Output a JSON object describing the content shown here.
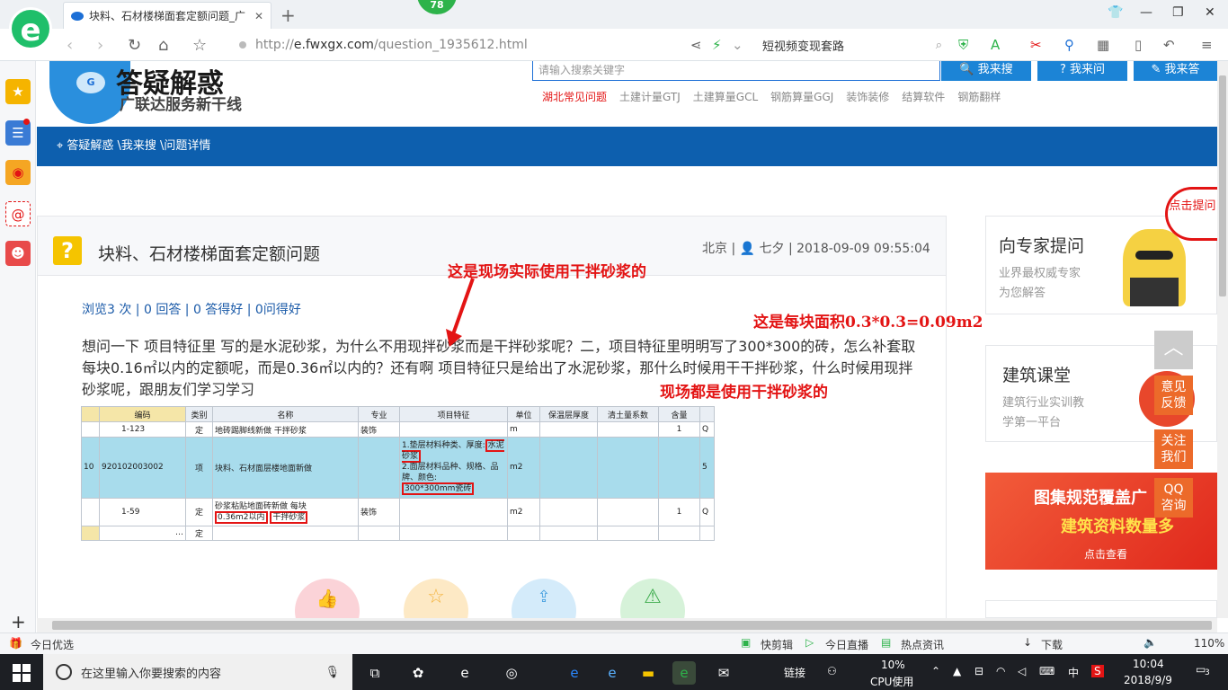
{
  "browser": {
    "tab_title": "块料、石材楼梯面套定额问题_广",
    "badge_count": "78",
    "url_host": "e.fwxgx.com",
    "url_prefix": "http://",
    "url_path": "/question_1935612.html",
    "search_text": "短视频变现套路",
    "status_left": "今日优选",
    "status_items": [
      "快剪辑",
      "今日直播",
      "热点资讯",
      "下载"
    ],
    "zoom": "110%"
  },
  "site": {
    "logo_title": "答疑解惑",
    "logo_subtitle": "广联达服务新干线",
    "search_placeholder": "请输入搜索关键字",
    "btn_search": "我来搜",
    "btn_ask": "我来问",
    "btn_answer": "我来答",
    "tags": [
      "湖北常见问题",
      "土建计量GTJ",
      "土建算量GCL",
      "钢筋算量GGJ",
      "装饰装修",
      "结算软件",
      "钢筋翻样"
    ],
    "breadcrumb": "答疑解惑 \\我来搜 \\问题详情"
  },
  "question": {
    "title": "块料、石材楼梯面套定额问题",
    "meta": "北京 | 👤 七夕 | 2018-09-09 09:55:04",
    "stats": "浏览3 次 | 0 回答 | 0 答得好 | 0问得好",
    "body": "想问一下 项目特征里 写的是水泥砂浆，为什么不用现拌砂浆而是干拌砂浆呢？二，项目特征里明明写了300*300的砖，怎么补套取每块0.16㎡以内的定额呢，而是0.36㎡以内的？还有啊  项目特征只是给出了水泥砂浆，那什么时候用干干拌砂浆，什么时候用现拌砂浆呢，跟朋友们学习学习"
  },
  "annotations": {
    "a1": "这是现场实际使用干拌砂浆的",
    "a2": "这是每块面积0.3*0.3=0.09m2",
    "a3": "现场都是使用干拌砂浆的"
  },
  "table": {
    "headers": [
      "编码",
      "类别",
      "名称",
      "专业",
      "项目特征",
      "单位",
      "保温层厚度",
      "清土量系数",
      "含量",
      ""
    ],
    "rows": [
      {
        "num": "",
        "code": "1-123",
        "type": "定",
        "name": "地砖踢脚线新做 干拌砂浆",
        "major": "装饰",
        "feature": "",
        "unit": "m",
        "qty": "1",
        "x": "Q"
      },
      {
        "num": "10",
        "code": "920102003002",
        "type": "项",
        "name": "块料、石材面层楼地面新做",
        "major": "",
        "feature_1": "1.垫层材料种类、厚度:",
        "feature_1b": "水泥砂浆",
        "feature_2": "2.面层材料品种、规格、品牌、颜色:",
        "feature_2b": "300*300mm瓷砖",
        "unit": "m2",
        "qty": "",
        "x": "5"
      },
      {
        "num": "",
        "code": "1-59",
        "type": "定",
        "name_a": "砂浆粘贴地面砖新做 每块",
        "name_b": "0.36m2以内",
        "name_c": "干拌砂浆",
        "major": "装饰",
        "feature": "",
        "unit": "m2",
        "qty": "1",
        "x": "Q"
      },
      {
        "num": "",
        "code": "…",
        "type": "定"
      }
    ]
  },
  "sidebar": {
    "expert_title": "向专家提问",
    "expert_sub1": "业界最权威专家",
    "expert_sub2": "为您解答",
    "course_title": "建筑课堂",
    "course_sub1": "建筑行业实训教",
    "course_sub2": "学第一平台",
    "banner_title": "图集规范覆盖广",
    "banner_sub": "建筑资料数量多",
    "banner_btn": "点击查看",
    "float_feedback": "意见反馈",
    "float_follow": "关注我们",
    "float_qq": "QQ咨询",
    "bubble": "点击提问"
  },
  "taskbar": {
    "search_placeholder": "在这里输入你要搜索的内容",
    "link": "链接",
    "cpu": "10%",
    "cpu_label": "CPU使用",
    "ime": "中",
    "time": "10:04",
    "date": "2018/9/9",
    "notif": "3"
  }
}
